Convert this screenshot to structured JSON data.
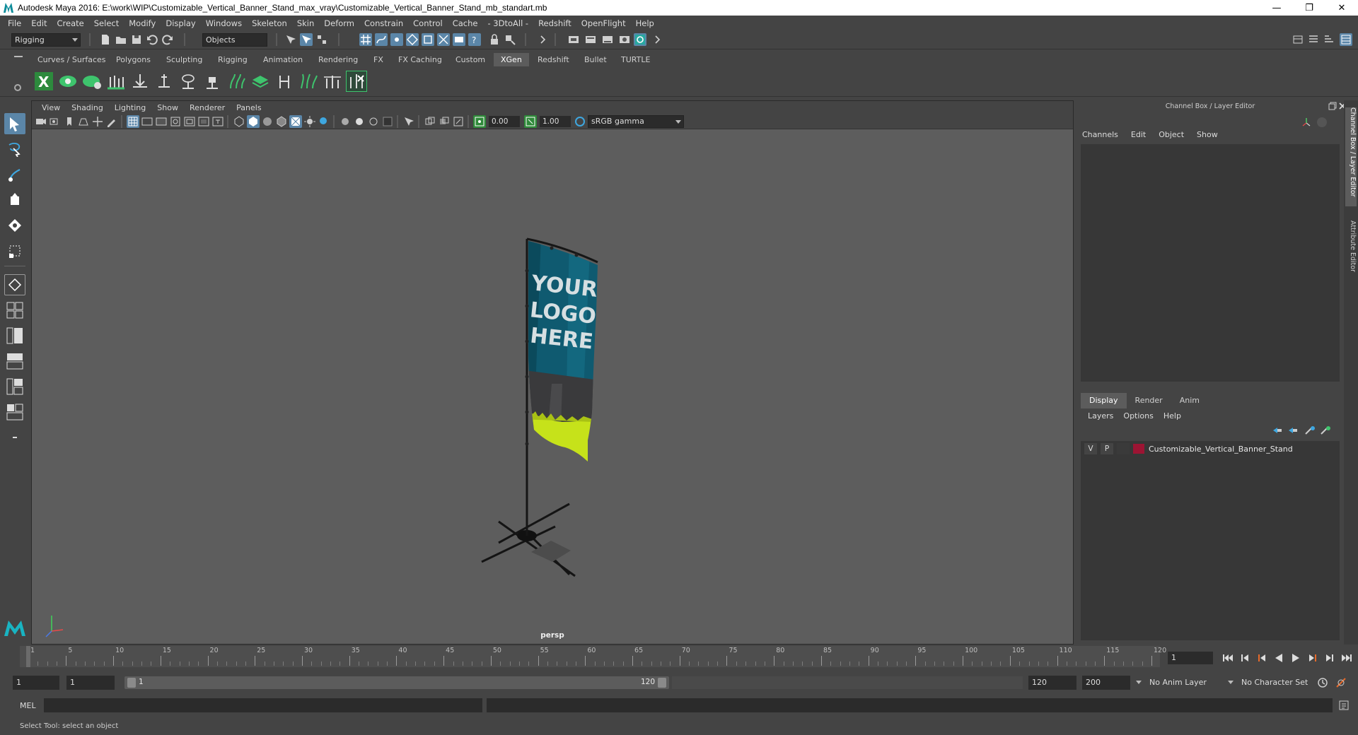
{
  "window": {
    "title": "Autodesk Maya 2016: E:\\work\\WIP\\Customizable_Vertical_Banner_Stand_max_vray\\Customizable_Vertical_Banner_Stand_mb_standart.mb",
    "minimize": "—",
    "restore": "❐",
    "close": "✕"
  },
  "menubar": {
    "items": [
      "File",
      "Edit",
      "Create",
      "Select",
      "Modify",
      "Display",
      "Windows",
      "Skeleton",
      "Skin",
      "Deform",
      "Constrain",
      "Control",
      "Cache",
      "- 3DtoAll -",
      "Redshift",
      "OpenFlight",
      "Help"
    ]
  },
  "statusline": {
    "mode": "Rigging",
    "selection_mode": "Objects"
  },
  "shelf": {
    "tabs": [
      "Curves / Surfaces",
      "Polygons",
      "Sculpting",
      "Rigging",
      "Animation",
      "Rendering",
      "FX",
      "FX Caching",
      "Custom",
      "XGen",
      "Redshift",
      "Bullet",
      "TURTLE"
    ],
    "active_tab": "XGen"
  },
  "viewport": {
    "menu": [
      "View",
      "Shading",
      "Lighting",
      "Show",
      "Renderer",
      "Panels"
    ],
    "exposure": "0.00",
    "gamma": "1.00",
    "color_space": "sRGB gamma",
    "camera": "persp",
    "banner_text": [
      "YOUR",
      "LOGO",
      "HERE"
    ],
    "colors": {
      "banner_teal": "#0f5a70",
      "banner_gray": "#3a3a3c",
      "banner_yellow": "#c6e21a"
    }
  },
  "right_panel": {
    "header": "Channel Box / Layer Editor",
    "menu": [
      "Channels",
      "Edit",
      "Object",
      "Show"
    ],
    "layer_tabs": [
      "Display",
      "Render",
      "Anim"
    ],
    "layer_menu": [
      "Layers",
      "Options",
      "Help"
    ],
    "layer": {
      "visible": "V",
      "playback": "P",
      "name": "Customizable_Vertical_Banner_Stand",
      "color": "#9c1433"
    },
    "side_tabs": [
      "Channel Box / Layer Editor",
      "Attribute Editor"
    ]
  },
  "timeline": {
    "ticks": [
      "1",
      "5",
      "10",
      "15",
      "20",
      "25",
      "30",
      "35",
      "40",
      "45",
      "50",
      "55",
      "60",
      "65",
      "70",
      "75",
      "80",
      "85",
      "90",
      "95",
      "100",
      "105",
      "110",
      "115",
      "120"
    ],
    "current_frame": "1"
  },
  "range": {
    "start": "1",
    "playback_start": "1",
    "range_start_label": "1",
    "range_end_label": "120",
    "playback_end": "120",
    "end": "200",
    "anim_layer": "No Anim Layer",
    "character_set": "No Character Set"
  },
  "cmdline": {
    "label": "MEL"
  },
  "helpline": {
    "text": "Select Tool: select an object"
  }
}
